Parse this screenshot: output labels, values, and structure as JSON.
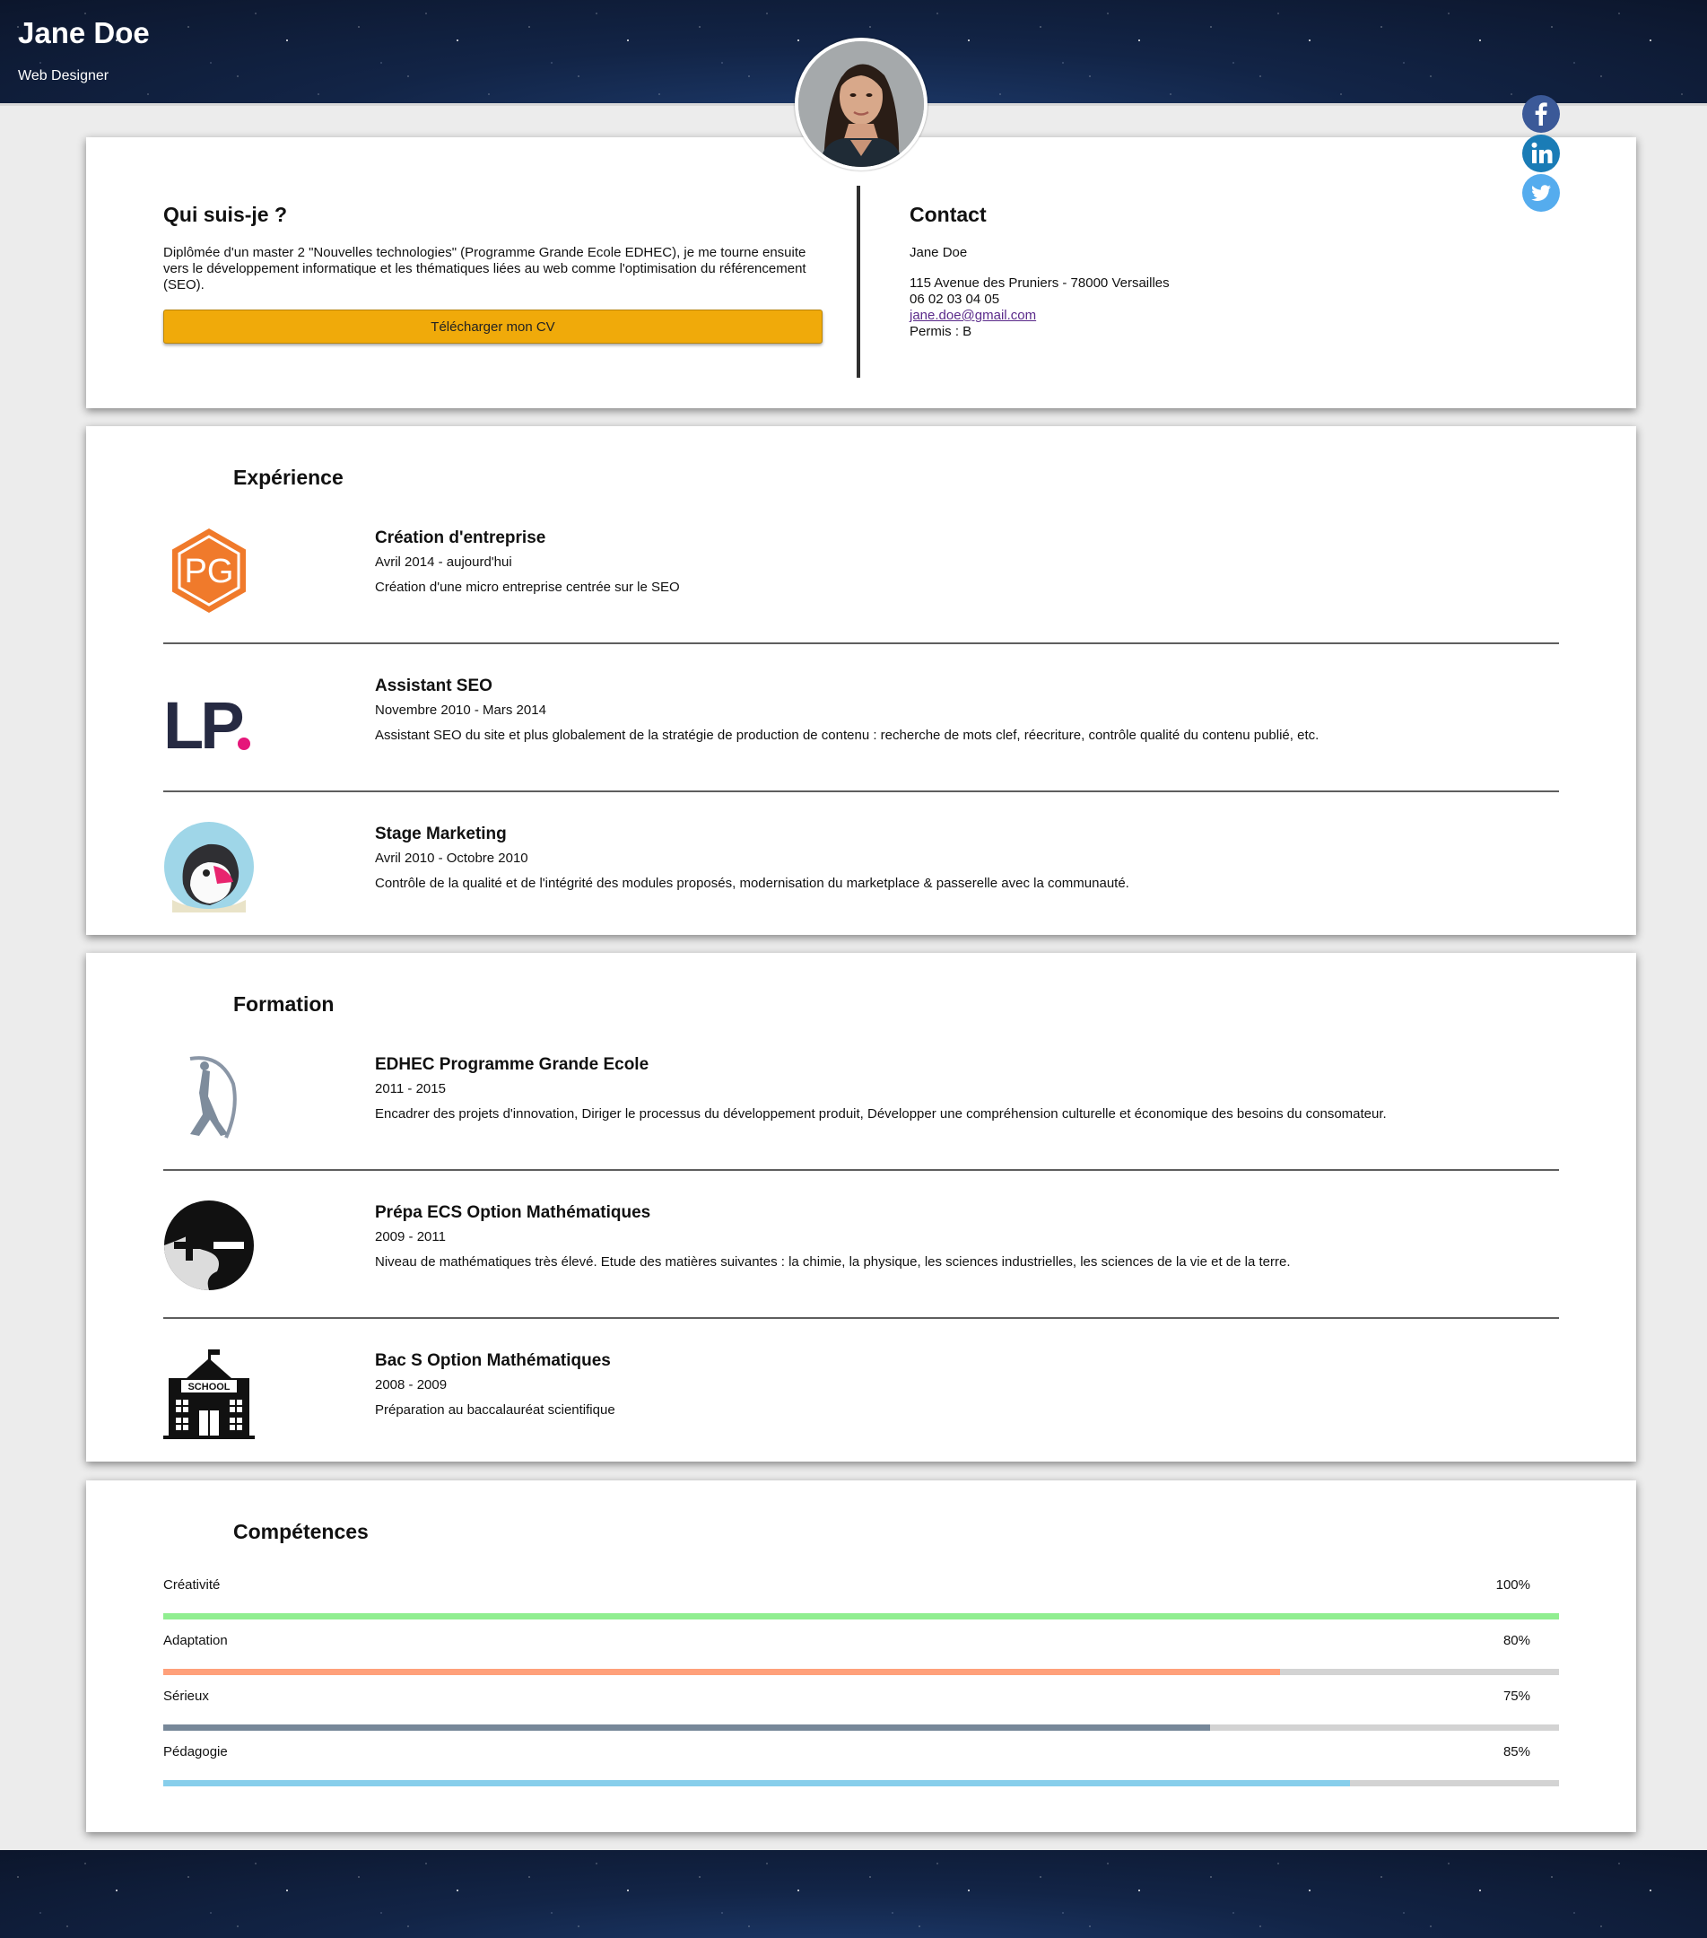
{
  "header": {
    "name": "Jane Doe",
    "role": "Web Designer"
  },
  "social": [
    "facebook-icon",
    "linkedin-icon",
    "twitter-icon"
  ],
  "about": {
    "title": "Qui suis-je ?",
    "text": "Diplômée d'un master 2 \"Nouvelles technologies\" (Programme Grande Ecole EDHEC), je me tourne ensuite vers le développement informatique et les thématiques liées au web comme l'optimisation du référencement (SEO).",
    "button": "Télécharger mon CV"
  },
  "contact": {
    "title": "Contact",
    "name": "Jane Doe",
    "address": "115 Avenue des Pruniers - 78000 Versailles",
    "phone": "06 02 03 04 05",
    "email": "jane.doe@gmail.com",
    "license": "Permis : B"
  },
  "experience": {
    "title": "Expérience",
    "items": [
      {
        "title": "Création d'entreprise",
        "dates": "Avril 2014 - aujourd'hui",
        "desc": "Création d'une micro entreprise centrée sur le SEO",
        "logo": "pg-hexagon-logo"
      },
      {
        "title": "Assistant SEO",
        "dates": "Novembre 2010 - Mars 2014",
        "desc": "Assistant SEO du site et plus globalement de la stratégie de production de contenu : recherche de mots clef, réecriture, contrôle qualité du contenu publié, etc.",
        "logo": "lp-logo"
      },
      {
        "title": "Stage Marketing",
        "dates": "Avril 2010 - Octobre 2010",
        "desc": "Contrôle de la qualité et de l'intégrité des modules proposés, modernisation du marketplace & passerelle avec la communauté.",
        "logo": "puffin-logo"
      }
    ]
  },
  "education": {
    "title": "Formation",
    "items": [
      {
        "title": "EDHEC Programme Grande Ecole",
        "dates": "2011 - 2015",
        "desc": "Encadrer des projets d'innovation, Diriger le processus du développement produit, Développer une compréhension culturelle et économique des besoins du consomateur.",
        "logo": "edhec-statue-logo"
      },
      {
        "title": "Prépa ECS Option Mathématiques",
        "dates": "2009 - 2011",
        "desc": "Niveau de mathématiques très élevé. Etude des matières suivantes : la chimie, la physique, les sciences industrielles, les sciences de la vie et de la terre.",
        "logo": "plus-minus-logo"
      },
      {
        "title": "Bac S Option Mathématiques",
        "dates": "2008 - 2009",
        "desc": "Préparation au baccalauréat scientifique",
        "logo": "school-building-icon",
        "logo_text": "SCHOOL"
      }
    ]
  },
  "skills": {
    "title": "Compétences",
    "items": [
      {
        "label": "Créativité",
        "percent_text": "100%",
        "level": 1.0,
        "color": "#90ee90"
      },
      {
        "label": "Adaptation",
        "percent_text": "80%",
        "level": 0.8,
        "color": "#ffa07a"
      },
      {
        "label": "Sérieux",
        "percent_text": "75%",
        "level": 0.75,
        "color": "#778899"
      },
      {
        "label": "Pédagogie",
        "percent_text": "85%",
        "level": 0.85,
        "color": "#87ceeb"
      }
    ]
  }
}
